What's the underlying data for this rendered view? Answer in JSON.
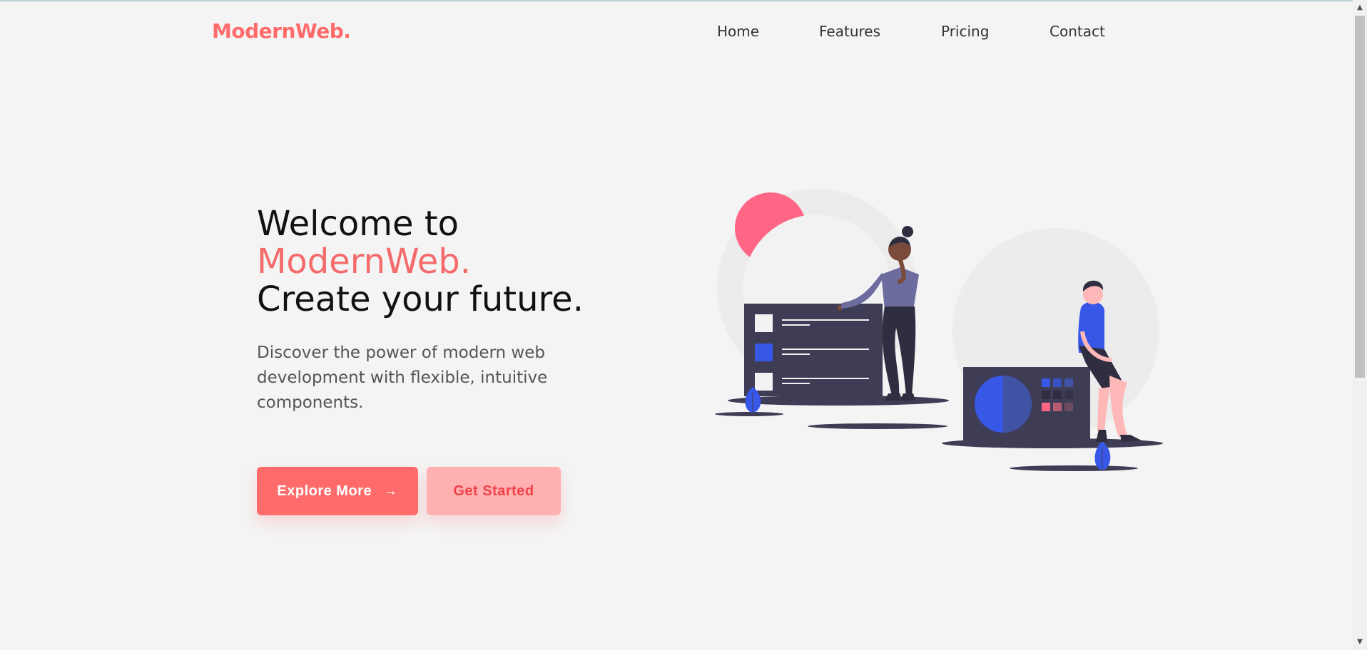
{
  "brand": {
    "logo": "ModernWeb."
  },
  "nav": {
    "items": [
      "Home",
      "Features",
      "Pricing",
      "Contact"
    ]
  },
  "hero": {
    "title_line1": "Welcome to",
    "title_line2": "ModernWeb.",
    "title_line3": "Create your future.",
    "subtitle": "Discover the power of modern web development with flexible, intuitive components.",
    "primary_button": "Explore More",
    "primary_button_icon": "arrow-right-icon",
    "secondary_button": "Get Started"
  },
  "colors": {
    "accent": "#ff6b6b",
    "accent_light": "#ffb0b0",
    "background": "#f4f4f4",
    "illustration_blue": "#3757e6",
    "illustration_dark": "#3f3d56"
  }
}
